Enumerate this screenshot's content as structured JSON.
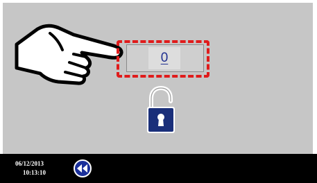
{
  "entry": {
    "value": "0"
  },
  "status_bar": {
    "date": "06/12/2013",
    "time": "10:13:10"
  },
  "icons": {
    "hand": "pointing-hand-icon",
    "lock": "unlocked-padlock-icon",
    "back": "rewind-back-icon"
  },
  "colors": {
    "screen_bg": "#c6c6c6",
    "highlight": "#e01b1b",
    "value_text": "#1f2f8f",
    "lock_body": "#1a2f7a",
    "status_bar_bg": "#000000"
  }
}
